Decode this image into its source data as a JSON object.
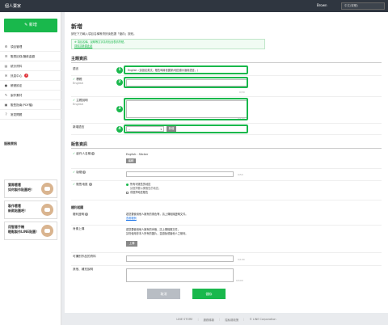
{
  "topbar": {
    "title": "個人賣家",
    "user": "Brown",
    "lang_select": "中文(繁體)"
  },
  "sidebar": {
    "new_button": "新增",
    "items": [
      {
        "icon": "gear-icon",
        "glyph": "⚙",
        "label": "項目管理"
      },
      {
        "icon": "list-icon",
        "glyph": "☰",
        "label": "販賣記錄/匯款金額"
      },
      {
        "icon": "chart-icon",
        "glyph": "▤",
        "label": "統計資料"
      },
      {
        "icon": "mail-icon",
        "glyph": "✉",
        "label": "訊息中心",
        "badge": "1"
      },
      {
        "icon": "person-icon",
        "glyph": "●",
        "label": "帳號設定"
      },
      {
        "icon": "edit-icon",
        "glyph": "✎",
        "label": "製作素材"
      },
      {
        "icon": "book-icon",
        "glyph": "▣",
        "label": "販售指南(PDF檔)"
      },
      {
        "icon": "help-icon",
        "glyph": "?",
        "label": "常見問題"
      }
    ],
    "section_title": "服務資訊",
    "promos": [
      {
        "line1": "實際看看",
        "line2": "如何製作貼圖吧！"
      },
      {
        "line1": "製作看看",
        "line2": "新款貼圖吧！"
      },
      {
        "line1": "用智慧手機",
        "line2": "輕鬆製作LINE貼圖！"
      }
    ]
  },
  "main": {
    "title": "新增",
    "description": "請在下方輸入項目名稱等資訊後點選「儲存」按鈕。",
    "note_line1": "※ 項目名稱、說明等文字請勿包含表情符號。",
    "note_link": "詳情請參閱此處",
    "section_basic": "主題資訊",
    "language_label": "語言",
    "language_value": "English（請設定英文。販售時將依國家/地區顯示適用語言。）",
    "title_label": "標題",
    "title_sublabel": "English",
    "title_counter": "0/30",
    "desc_label": "主題說明",
    "desc_sublabel": "English",
    "desc_counter": "0/160",
    "add_lang_label": "新增語言",
    "add_lang_select": "--",
    "add_lang_button": "新增",
    "markers": [
      "1",
      "2",
      "3",
      "4"
    ],
    "section_sales": "販售資訊",
    "creator_label": "創作人名稱",
    "creator_value": "English：Sticker",
    "creator_button": "編輯",
    "copyright_label": "版權",
    "copyright_counter": "0/50",
    "publish_label": "販售地區",
    "publish_all": "所有可販售的地區",
    "publish_note": "請選擇要公開販售的地區。",
    "publish_selected": "僅選擇地區販售",
    "subsection_rights": "權利相關",
    "rights_doc_label": "權利證明",
    "rights_doc_text": "若您要使用他人擁有的角色等，請上傳相關證明文件。",
    "rights_doc_link": "查看範例",
    "upload_label": "肖像上傳",
    "upload_text": "若您要使用他人擁有的肖像，請上傳相關文件。",
    "upload_text2": "請勿使用非本人所有的圖片，並避免侵害他人之權利。",
    "upload_button": "上傳",
    "company_label": "可識別作品的資料",
    "company_counter": "0/100",
    "notes_label": "其他、補充說明",
    "notes_counter": "0/500",
    "cancel_button": "取消",
    "save_button": "儲存"
  },
  "footer": {
    "links": [
      "LINE STORE",
      "服務條款",
      "隱私權政策"
    ],
    "copyright": "© LINE Corporation"
  }
}
